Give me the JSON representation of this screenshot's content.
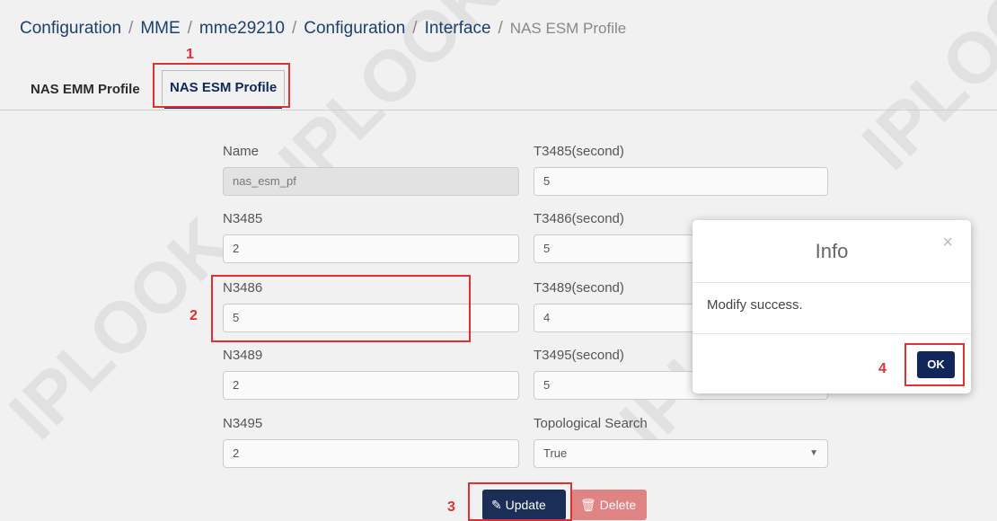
{
  "breadcrumb": {
    "items": [
      "Configuration",
      "MME",
      "mme29210",
      "Configuration",
      "Interface"
    ],
    "separator": "/",
    "current": "NAS ESM Profile"
  },
  "tabs": [
    {
      "label": "NAS EMM Profile",
      "active": false
    },
    {
      "label": "NAS ESM Profile",
      "active": true
    }
  ],
  "form": {
    "name": {
      "label": "Name",
      "value": "nas_esm_pf"
    },
    "n3485": {
      "label": "N3485",
      "value": "2"
    },
    "n3486": {
      "label": "N3486",
      "value": "5"
    },
    "n3489": {
      "label": "N3489",
      "value": "2"
    },
    "n3495": {
      "label": "N3495",
      "value": "2"
    },
    "t3485": {
      "label": "T3485(second)",
      "value": "5"
    },
    "t3486": {
      "label": "T3486(second)",
      "value": "5"
    },
    "t3489": {
      "label": "T3489(second)",
      "value": "4"
    },
    "t3495": {
      "label": "T3495(second)",
      "value": "5"
    },
    "topological": {
      "label": "Topological Search",
      "value": "True"
    }
  },
  "buttons": {
    "update": "Update",
    "delete": "Delete"
  },
  "modal": {
    "title": "Info",
    "close": "×",
    "message": "Modify success.",
    "ok": "OK"
  },
  "annotations": [
    "1",
    "2",
    "3",
    "4"
  ],
  "watermark": "IPLOOK",
  "colors": {
    "accent": "#11265a",
    "annotation": "#e03030",
    "delete": "#d95555"
  }
}
